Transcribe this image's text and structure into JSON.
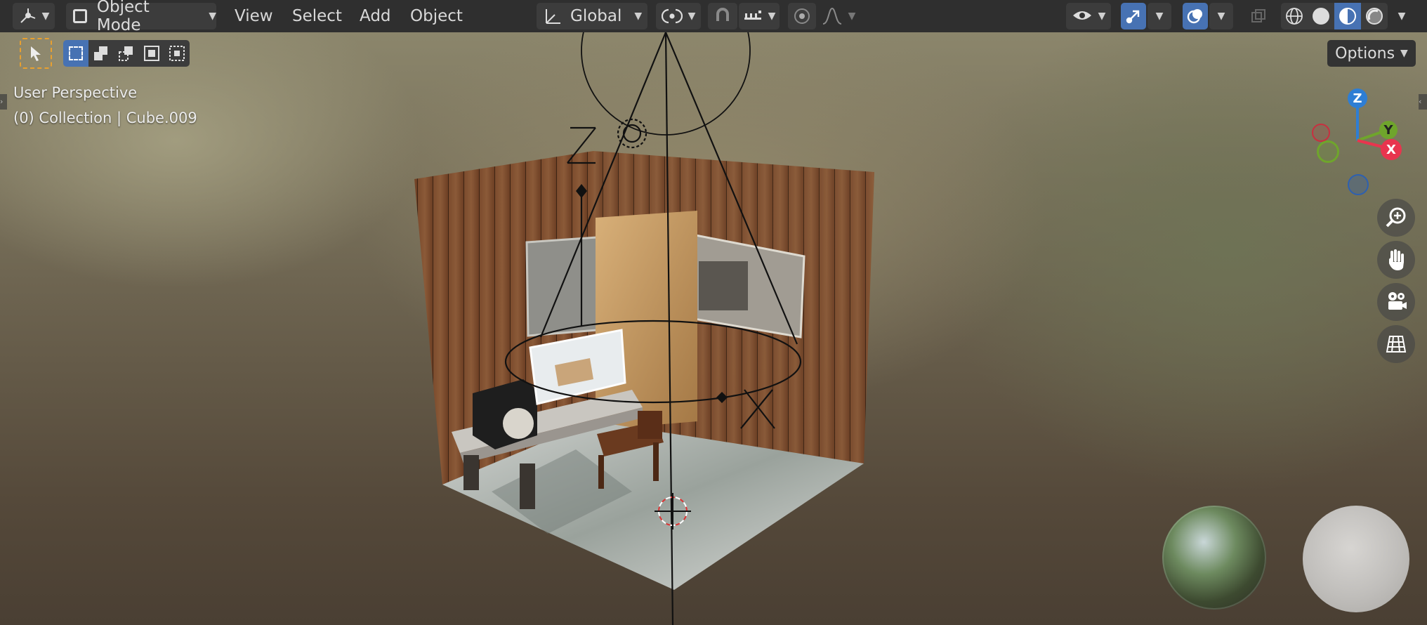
{
  "header": {
    "editor_type_icon": "3d-viewport-icon",
    "mode_label": "Object Mode",
    "menus": [
      "View",
      "Select",
      "Add",
      "Object"
    ],
    "orientation_label": "Global",
    "options_label": "Options"
  },
  "overlay": {
    "view_name": "User Perspective",
    "collection_info": "(0) Collection | Cube.009"
  },
  "gizmo": {
    "z_label": "Z",
    "y_label": "Y",
    "x_label": "X",
    "colors": {
      "x": "#e8354e",
      "y": "#6fa52c",
      "z": "#2e7ed4"
    }
  },
  "scene_annotations": {
    "light_z_label": "Z",
    "axis_x_label": "X"
  },
  "icons": {
    "select_tool": "cursor-arrow-icon",
    "select_modes": [
      "select-new-icon",
      "select-extend-icon",
      "select-subtract-icon",
      "select-invert-icon",
      "select-intersect-icon"
    ],
    "nav": [
      "zoom-icon",
      "pan-hand-icon",
      "camera-icon",
      "grid-ortho-icon"
    ],
    "shading": [
      "wireframe-icon",
      "solid-icon",
      "material-preview-icon",
      "rendered-icon"
    ]
  },
  "colors": {
    "accent": "#4772b3",
    "tool_highlight": "#e8a030"
  }
}
